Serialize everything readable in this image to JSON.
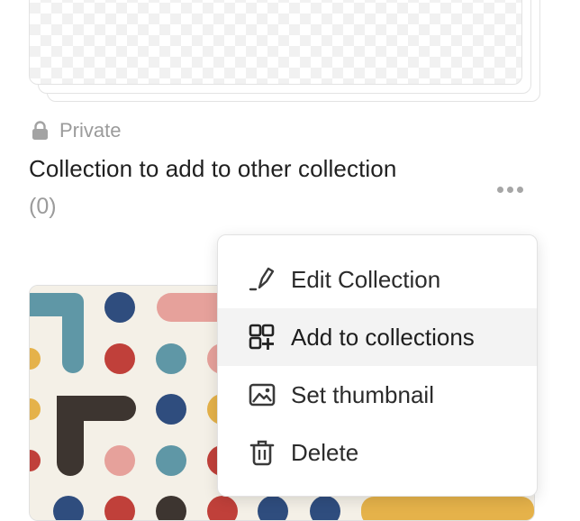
{
  "collection": {
    "privacy_label": "Private",
    "title": "Collection to add to other collection",
    "count_label": "(0)"
  },
  "icons": {
    "lock": "lock-icon",
    "more": "more-horizontal-icon",
    "edit": "pencil-edit-icon",
    "add": "grid-plus-icon",
    "thumbnail": "image-icon",
    "delete": "trash-icon"
  },
  "menu": {
    "items": [
      {
        "label": "Edit Collection",
        "icon": "pencil-edit-icon"
      },
      {
        "label": "Add to collections",
        "icon": "grid-plus-icon",
        "highlighted": true
      },
      {
        "label": "Set thumbnail",
        "icon": "image-icon"
      },
      {
        "label": "Delete",
        "icon": "trash-icon"
      }
    ]
  },
  "colors": {
    "text": "#1f1f1f",
    "muted": "#9b9b9b",
    "menu_highlight": "#f3f3f3",
    "pattern_teal": "#5f97a6",
    "pattern_navy": "#2f4d7e",
    "pattern_red": "#c0403a",
    "pattern_pink": "#e6a19b",
    "pattern_yellow": "#e5b24a",
    "pattern_dark": "#3d3530",
    "pattern_bg": "#f4f0e7"
  }
}
